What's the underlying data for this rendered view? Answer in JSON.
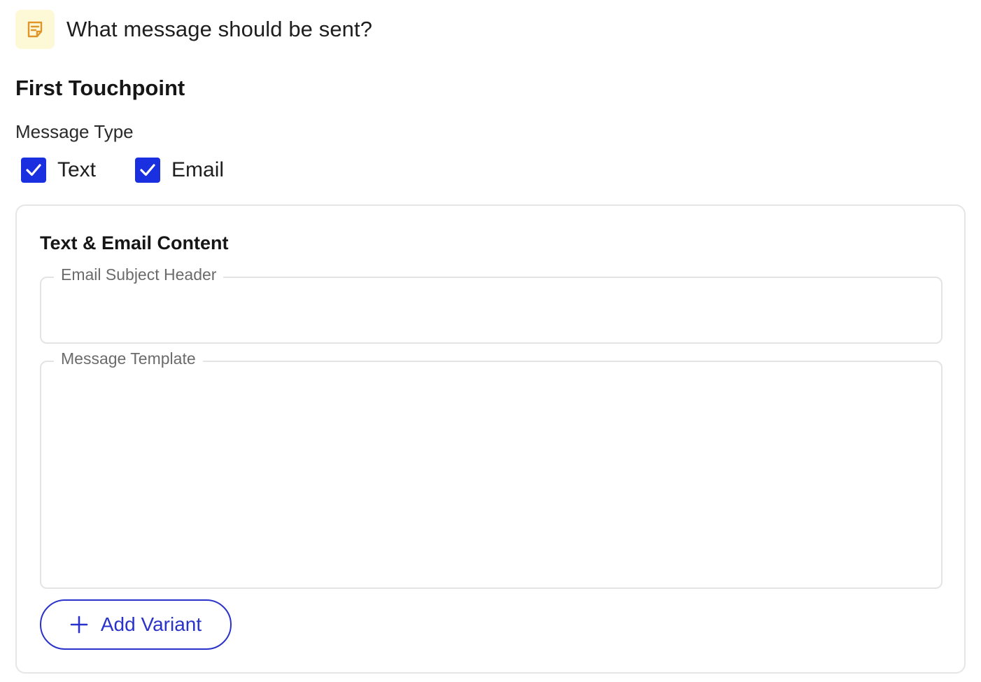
{
  "question": {
    "icon": "note-icon",
    "text": "What message should be sent?"
  },
  "touchpoint": {
    "title": "First Touchpoint",
    "message_type_label": "Message Type",
    "options": [
      {
        "label": "Text",
        "checked": true
      },
      {
        "label": "Email",
        "checked": true
      }
    ]
  },
  "content": {
    "title": "Text & Email Content",
    "subject_field": {
      "label": "Email Subject Header",
      "value": ""
    },
    "template_field": {
      "label": "Message Template",
      "value": ""
    },
    "add_variant_label": "Add Variant"
  },
  "colors": {
    "accent": "#1a2fe0",
    "button_border": "#2a33c9",
    "icon_bg": "#fdf8d6",
    "icon_stroke": "#e0952a"
  }
}
